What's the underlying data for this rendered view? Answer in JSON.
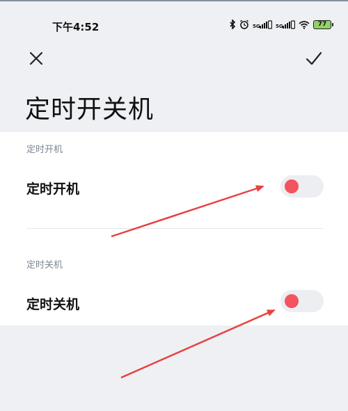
{
  "status_bar": {
    "time": "下午4:52",
    "icons": [
      "bluetooth-icon",
      "alarm-icon",
      "signal-icon",
      "signal-icon",
      "wifi-icon",
      "battery-icon"
    ],
    "battery_level": "77"
  },
  "header": {
    "close_icon": "close-icon",
    "confirm_icon": "check-icon",
    "title": "定时开关机"
  },
  "sections": [
    {
      "header": "定时开机",
      "row_label": "定时开机",
      "enabled": false
    },
    {
      "header": "定时关机",
      "row_label": "定时关机",
      "enabled": false
    }
  ],
  "colors": {
    "background": "#eef0f3",
    "card": "#ffffff",
    "toggle_track": "#eceef1",
    "toggle_knob": "#f4545d",
    "section_label": "#7d8794",
    "annotation_arrow": "#e8413f"
  }
}
